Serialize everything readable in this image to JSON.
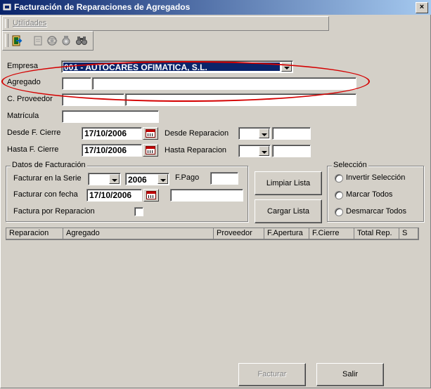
{
  "window": {
    "title": "Facturación de Reparaciones de Agregados",
    "close": "×"
  },
  "menu": {
    "utilidades": "Utilidades"
  },
  "toolbar": {
    "icons": [
      "exit-icon",
      "new-doc-icon",
      "view-icon",
      "settings-icon",
      "search-binoculars-icon"
    ]
  },
  "form": {
    "empresa": {
      "label": "Empresa",
      "value": "001 - AUTOCARES OFIMATICA, S.L."
    },
    "agregado": {
      "label": "Agregado",
      "code": "",
      "name": ""
    },
    "proveedor": {
      "label": "C. Proveedor",
      "code": "",
      "name": ""
    },
    "matricula": {
      "label": "Matrícula",
      "value": ""
    },
    "desde_cierre": {
      "label": "Desde F. Cierre",
      "value": "17/10/2006"
    },
    "hasta_cierre": {
      "label": "Hasta F. Cierre",
      "value": "17/10/2006"
    },
    "desde_reparacion": {
      "label": "Desde Reparacion",
      "serie": "",
      "value": ""
    },
    "hasta_reparacion": {
      "label": "Hasta Reparacion",
      "serie": "",
      "value": ""
    }
  },
  "facturacion": {
    "legend": "Datos de Facturación",
    "serie_label": "Facturar en la Serie",
    "serie_value": "",
    "year_value": "2006",
    "fpago_label": "F.Pago",
    "fpago_value": "",
    "fecha_label": "Facturar con fecha",
    "fecha_value": "17/10/2006",
    "fecha_extra": "",
    "por_reparacion_label": "Factura por Reparacion"
  },
  "buttons": {
    "limpiar": "Limpiar Lista",
    "cargar": "Cargar Lista",
    "facturar": "Facturar",
    "salir": "Salir"
  },
  "seleccion": {
    "legend": "Selección",
    "options": [
      "Invertir Selección",
      "Marcar Todos",
      "Desmarcar Todos"
    ]
  },
  "grid": {
    "columns": [
      "Reparacion",
      "Agregado",
      "Proveedor",
      "F.Apertura",
      "F.Cierre",
      "Total Rep.",
      "S"
    ]
  },
  "colors": {
    "title_start": "#0a246a",
    "title_end": "#a6caf0",
    "face": "#d4d0c8",
    "annotation": "#d40000",
    "selection": "#0a246a"
  }
}
